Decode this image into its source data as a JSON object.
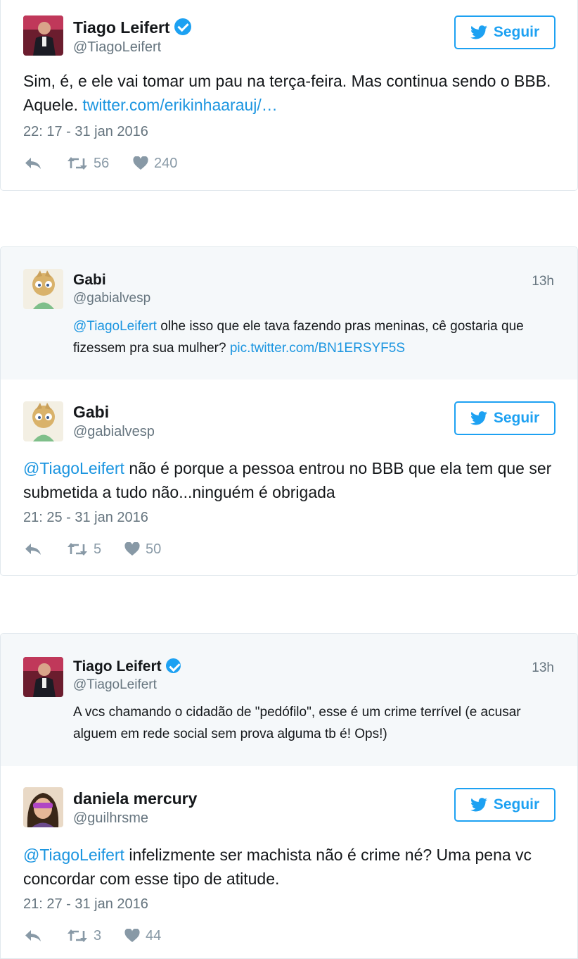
{
  "colors": {
    "accent": "#1da1f2",
    "link": "#1b95e0",
    "muted": "#66757f",
    "icon": "#8899a6",
    "quoted_bg": "#f5f8fa"
  },
  "tweets": [
    {
      "name": "Tiago Leifert",
      "verified": true,
      "handle": "@TiagoLeifert",
      "follow_label": "Seguir",
      "text": "Sim, é, e ele vai tomar um pau na terça-feira. Mas continua sendo o BBB. Aquele. ",
      "link": "twitter.com/erikinhaarauj/…",
      "date": "22: 17 - 31 jan 2016",
      "retweets": "56",
      "likes": "240"
    },
    {
      "quoted": {
        "name": "Gabi",
        "handle": "@gabialvesp",
        "time_ago": "13h",
        "mention": "@TiagoLeifert",
        "text": " olhe isso que ele tava fazendo pras meninas, cê gostaria que fizessem pra sua mulher? ",
        "link": "pic.twitter.com/BN1ERSYF5S"
      },
      "name": "Gabi",
      "handle": "@gabialvesp",
      "follow_label": "Seguir",
      "mention": "@TiagoLeifert",
      "text": " não é porque a pessoa entrou no BBB que ela tem que ser submetida a tudo não...ninguém é obrigada",
      "date": "21: 25 - 31 jan 2016",
      "retweets": "5",
      "likes": "50"
    },
    {
      "quoted": {
        "name": "Tiago Leifert",
        "verified": true,
        "handle": "@TiagoLeifert",
        "time_ago": "13h",
        "text": "A vcs chamando o cidadão de \"pedófilo\", esse é um crime terrível (e acusar alguem em rede social sem prova alguma tb é! Ops!)"
      },
      "name": "daniela mercury",
      "handle": "@guilhrsme",
      "follow_label": "Seguir",
      "mention": "@TiagoLeifert",
      "text": " infelizmente ser machista não é crime né? Uma pena vc concordar com esse tipo de atitude.",
      "date": "21: 27 - 31 jan 2016",
      "retweets": "3",
      "likes": "44"
    }
  ]
}
